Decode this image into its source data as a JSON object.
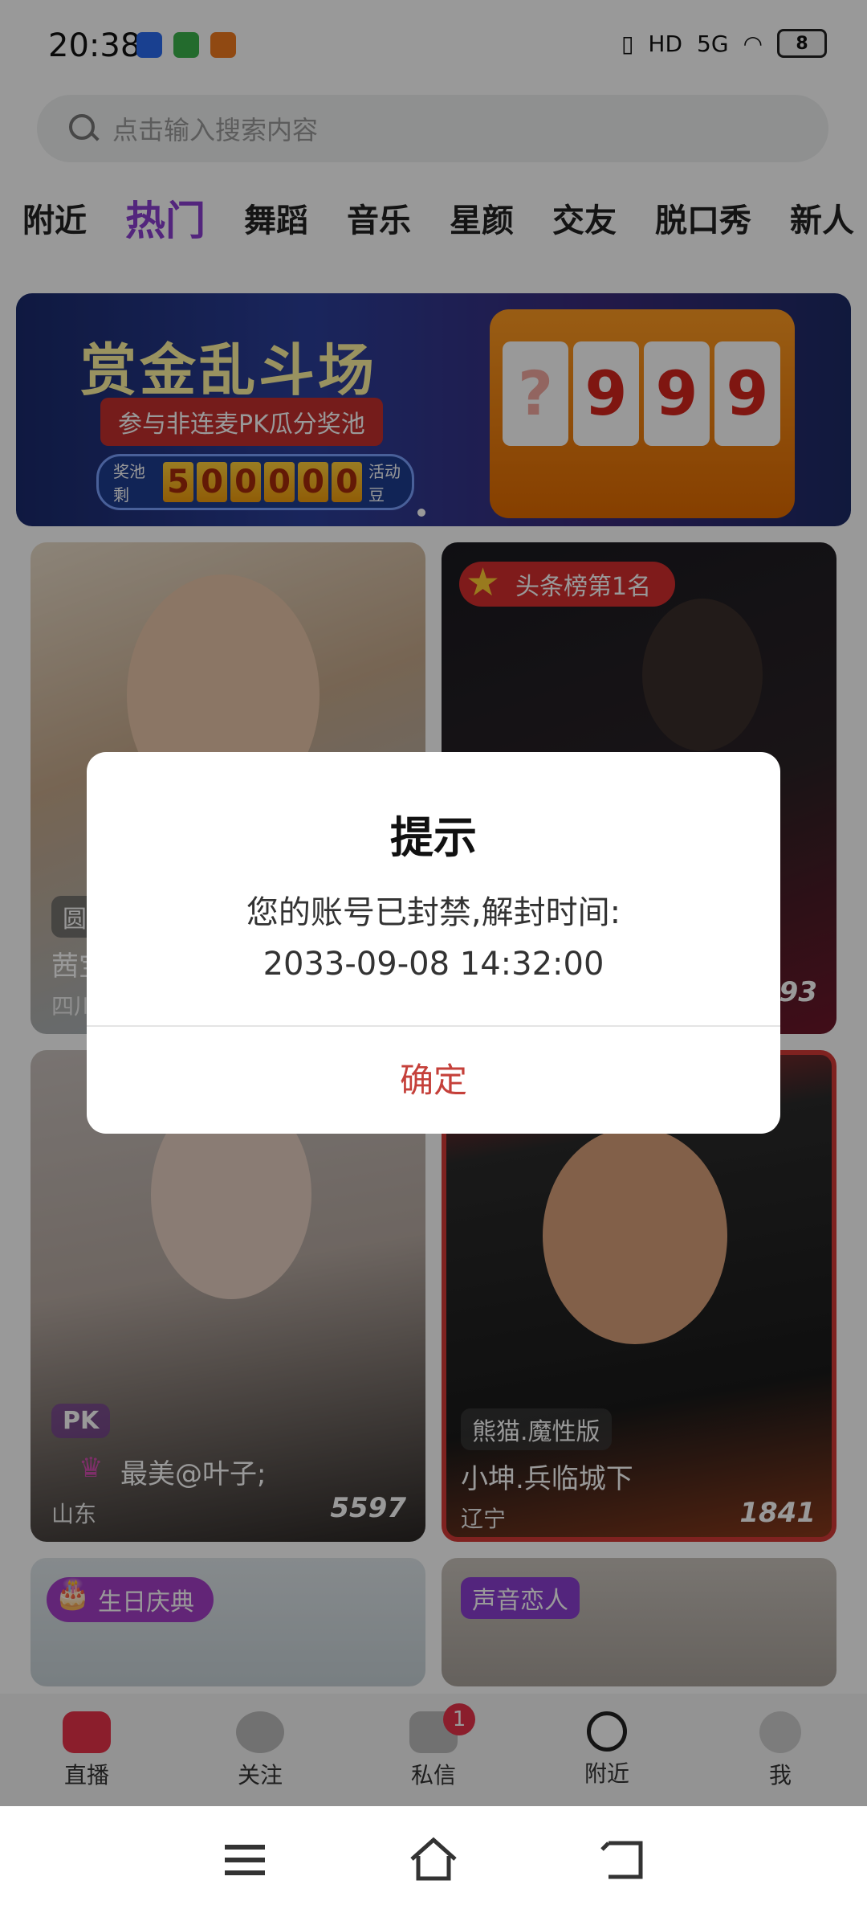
{
  "status_bar": {
    "time": "20:38",
    "network": "5G",
    "hd": "HD",
    "battery": "8"
  },
  "search": {
    "placeholder": "点击输入搜索内容"
  },
  "tabs": [
    "附近",
    "热门",
    "舞蹈",
    "音乐",
    "星颜",
    "交友",
    "脱口秀",
    "新人"
  ],
  "active_tab": "热门",
  "banner": {
    "title": "赏金乱斗场",
    "subtitle": "参与非连麦PK瓜分奖池",
    "pool_prefix": "奖池剩",
    "pool_digits": [
      "5",
      "0",
      "0",
      "0",
      "0",
      "0"
    ],
    "pool_suffix": "活动豆",
    "reels": [
      "?",
      "9",
      "9",
      "9"
    ]
  },
  "cards": [
    {
      "tag": "圆",
      "name": "茜宝",
      "location": "四川",
      "count": ""
    },
    {
      "tag": "头条榜第1名",
      "name": "",
      "location": "",
      "count": "493"
    },
    {
      "tag": "PK",
      "name": "最美@叶子;",
      "location": "山东",
      "count": "5597"
    },
    {
      "tag": "熊猫.魔性版",
      "name": "小坤.兵临城下",
      "location": "辽宁",
      "count": "1841"
    },
    {
      "tag": "生日庆典",
      "name": "",
      "location": "",
      "count": ""
    },
    {
      "tag": "声音恋人",
      "name": "",
      "location": "",
      "count": ""
    }
  ],
  "nav": {
    "live": "直播",
    "follow": "关注",
    "messages": "私信",
    "messages_badge": "1",
    "nearby": "附近",
    "me": "我"
  },
  "dialog": {
    "title": "提示",
    "message_line1": "您的账号已封禁,解封时间:",
    "message_line2": "2033-09-08 14:32:00",
    "confirm": "确定"
  },
  "colors": {
    "accent": "#8a3fd1",
    "confirm_text": "#c5403a",
    "live_icon": "#e8334a"
  }
}
